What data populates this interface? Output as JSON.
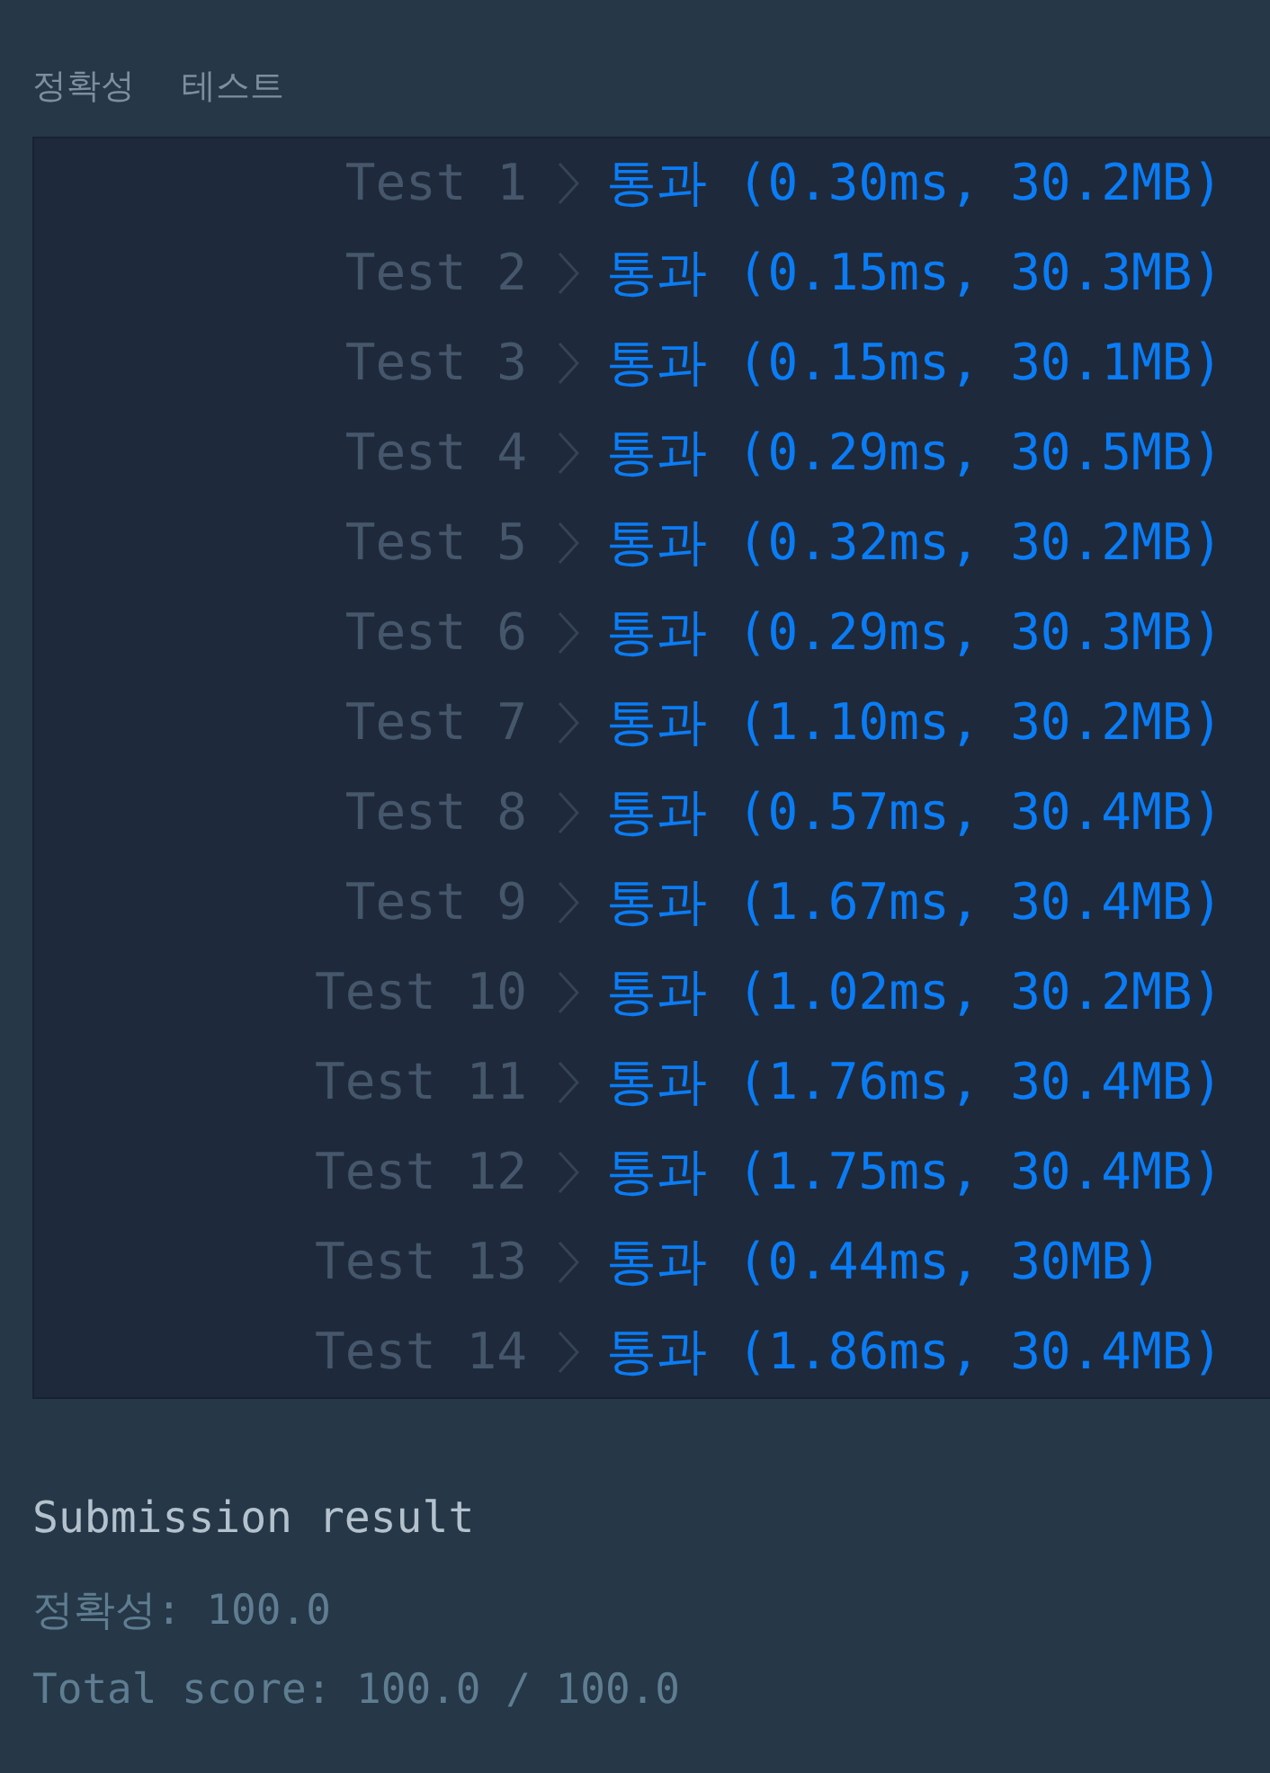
{
  "heading": "정확성 테스트",
  "tests": [
    {
      "label": "Test 1",
      "result": "통과 (0.30ms, 30.2MB)"
    },
    {
      "label": "Test 2",
      "result": "통과 (0.15ms, 30.3MB)"
    },
    {
      "label": "Test 3",
      "result": "통과 (0.15ms, 30.1MB)"
    },
    {
      "label": "Test 4",
      "result": "통과 (0.29ms, 30.5MB)"
    },
    {
      "label": "Test 5",
      "result": "통과 (0.32ms, 30.2MB)"
    },
    {
      "label": "Test 6",
      "result": "통과 (0.29ms, 30.3MB)"
    },
    {
      "label": "Test 7",
      "result": "통과 (1.10ms, 30.2MB)"
    },
    {
      "label": "Test 8",
      "result": "통과 (0.57ms, 30.4MB)"
    },
    {
      "label": "Test 9",
      "result": "통과 (1.67ms, 30.4MB)"
    },
    {
      "label": "Test 10",
      "result": "통과 (1.02ms, 30.2MB)"
    },
    {
      "label": "Test 11",
      "result": "통과 (1.76ms, 30.4MB)"
    },
    {
      "label": "Test 12",
      "result": "통과 (1.75ms, 30.4MB)"
    },
    {
      "label": "Test 13",
      "result": "통과 (0.44ms, 30MB)"
    },
    {
      "label": "Test 14",
      "result": "통과 (1.86ms, 30.4MB)"
    }
  ],
  "summary": {
    "title": "Submission result",
    "lines": [
      "정확성: 100.0",
      "Total score: 100.0 / 100.0"
    ]
  }
}
